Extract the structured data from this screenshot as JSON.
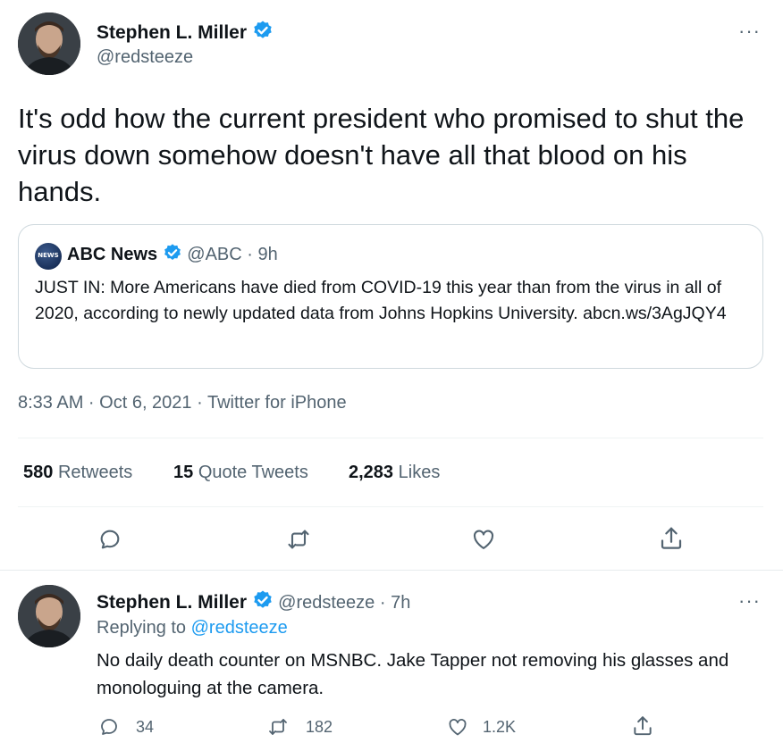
{
  "main_tweet": {
    "author_name": "Stephen L. Miller",
    "author_handle": "@redsteeze",
    "text": "It's odd how the current president who promised to shut the virus down somehow doesn't have all that blood on his hands.",
    "more": "···",
    "meta": "8:33 AM · Oct 6, 2021 · Twitter for iPhone"
  },
  "quoted": {
    "author_name": "ABC News",
    "author_handle_time": "@ABC · 9h",
    "logo_text": "NEWS",
    "text": "JUST IN: More Americans have died from COVID-19 this year than from the virus in all of 2020, according to newly updated data from Johns Hopkins University. abcn.ws/3AgJQY4"
  },
  "stats": {
    "retweets_count": "580",
    "retweets_label": "Retweets",
    "quotes_count": "15",
    "quotes_label": "Quote Tweets",
    "likes_count": "2,283",
    "likes_label": "Likes"
  },
  "actions": [
    "reply-icon",
    "retweet-icon",
    "like-icon",
    "share-icon"
  ],
  "reply": {
    "author_name": "Stephen L. Miller",
    "author_handle_time": "@redsteeze · 7h",
    "more": "···",
    "replying_prefix": "Replying to",
    "replying_handle": "@redsteeze",
    "text": "No daily death counter on MSNBC. Jake Tapper not removing his glasses and monologuing at the camera.",
    "reply_count": "34",
    "retweet_count": "182",
    "like_count": "1.2K"
  },
  "colors": {
    "text": "#0f1419",
    "muted": "#536471",
    "accent": "#1d9bf0",
    "border": "#cfd9de",
    "divider": "#eff3f4"
  }
}
